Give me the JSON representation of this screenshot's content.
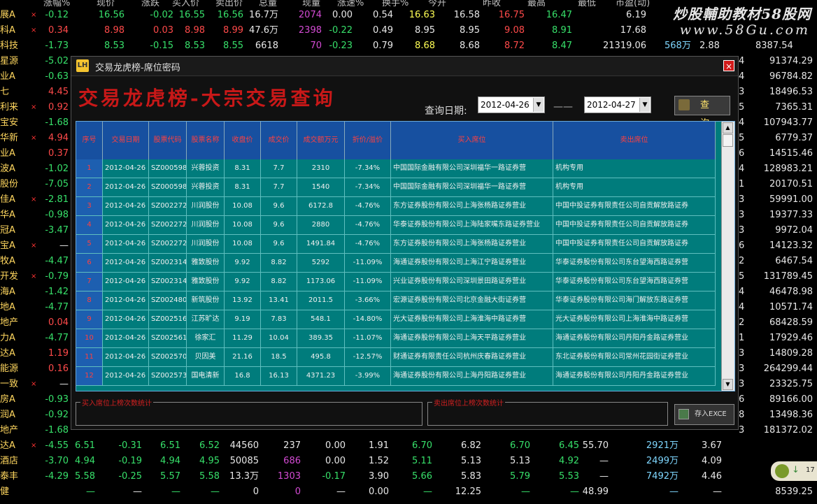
{
  "background": {
    "header": [
      "涨幅%",
      "现价",
      "涨跌",
      "买入价",
      "卖出价",
      "总量",
      "现量",
      "涨速%",
      "换手%",
      "今开",
      "昨收",
      "最高",
      "最低",
      "市盈(动)"
    ],
    "watermark": {
      "line1": "炒股輔助教材58股网",
      "line2": "www.58Gu.com"
    },
    "left_rows": [
      {
        "name": "展A",
        "x": "×",
        "chg": "-0.12"
      },
      {
        "name": "科A",
        "x": "×",
        "chg": "0.34"
      },
      {
        "name": "科技",
        "x": "",
        "chg": "-1.73"
      },
      {
        "name": "星源",
        "x": "",
        "chg": "-5.02"
      },
      {
        "name": "业A",
        "x": "",
        "chg": "-0.63"
      },
      {
        "name": "七",
        "x": "",
        "chg": "4.45"
      },
      {
        "name": "利来",
        "x": "×",
        "chg": "0.92"
      },
      {
        "name": "宝安",
        "x": "",
        "chg": "-1.68"
      },
      {
        "name": "华新",
        "x": "×",
        "chg": "4.94"
      },
      {
        "name": "业A",
        "x": "",
        "chg": "0.37"
      },
      {
        "name": "波A",
        "x": "",
        "chg": "-1.02"
      },
      {
        "name": "股份",
        "x": "",
        "chg": "-7.05"
      },
      {
        "name": "佳A",
        "x": "×",
        "chg": "-2.81"
      },
      {
        "name": "华A",
        "x": "",
        "chg": "-0.98"
      },
      {
        "name": "冠A",
        "x": "",
        "chg": "-3.47"
      },
      {
        "name": "宝A",
        "x": "×",
        "chg": "—"
      },
      {
        "name": "牧A",
        "x": "",
        "chg": "-4.47"
      },
      {
        "name": "开发",
        "x": "×",
        "chg": "-0.79"
      },
      {
        "name": "海A",
        "x": "",
        "chg": "-1.42"
      },
      {
        "name": "地A",
        "x": "",
        "chg": "-4.77"
      },
      {
        "name": "地产",
        "x": "",
        "chg": "0.04"
      },
      {
        "name": "力A",
        "x": "",
        "chg": "-4.77"
      },
      {
        "name": "达A",
        "x": "",
        "chg": "1.19"
      },
      {
        "name": "能源",
        "x": "",
        "chg": "0.16"
      },
      {
        "name": "一致",
        "x": "×",
        "chg": "—"
      },
      {
        "name": "房A",
        "x": "",
        "chg": "-0.93"
      },
      {
        "name": "润A",
        "x": "",
        "chg": "-0.92"
      },
      {
        "name": "地产",
        "x": "",
        "chg": "-1.68"
      },
      {
        "name": "达A",
        "x": "×",
        "chg": "-4.55"
      },
      {
        "name": "酒店",
        "x": "",
        "chg": "-3.70"
      },
      {
        "name": "泰丰",
        "x": "",
        "chg": "-4.29"
      },
      {
        "name": "健",
        "x": "",
        "chg": ""
      }
    ],
    "top_rows": [
      [
        "16.56",
        "-0.02",
        "16.55",
        "16.56",
        "16.7万",
        "2074",
        "0.00",
        "0.54",
        "16.63",
        "16.58",
        "16.75",
        "16.47",
        "6.19"
      ],
      [
        "8.98",
        "0.03",
        "8.98",
        "8.99",
        "47.6万",
        "2398",
        "-0.22",
        "0.49",
        "8.95",
        "8.95",
        "9.08",
        "8.91",
        "17.68"
      ],
      [
        "8.53",
        "-0.15",
        "8.53",
        "8.55",
        "6618",
        "70",
        "-0.23",
        "0.79",
        "8.68",
        "8.68",
        "8.72",
        "8.47",
        "21319.06"
      ]
    ],
    "top_extra": {
      "row3_col14": "568万",
      "row3_col15": "2.88",
      "row3_col16": "8387.54"
    },
    "right_cols": [
      {
        "a": "4",
        "b": "91374.29"
      },
      {
        "a": "4",
        "b": "96784.82"
      },
      {
        "a": "3",
        "b": "18496.53"
      },
      {
        "a": "5",
        "b": "7365.31"
      },
      {
        "a": "4",
        "b": "107943.77"
      },
      {
        "a": "5",
        "b": "6779.37"
      },
      {
        "a": "6",
        "b": "14515.46"
      },
      {
        "a": "4",
        "b": "128983.21"
      },
      {
        "a": "1",
        "b": "20170.51"
      },
      {
        "a": "3",
        "b": "59991.00"
      },
      {
        "a": "3",
        "b": "19377.33"
      },
      {
        "a": "3",
        "b": "9972.04"
      },
      {
        "a": "6",
        "b": "14123.32"
      },
      {
        "a": "2",
        "b": "6467.54"
      },
      {
        "a": "5",
        "b": "131789.45"
      },
      {
        "a": "4",
        "b": "46478.98"
      },
      {
        "a": "4",
        "b": "10571.74"
      },
      {
        "a": "2",
        "b": "68428.59"
      },
      {
        "a": "1",
        "b": "17929.46"
      },
      {
        "a": "3",
        "b": "14809.28"
      },
      {
        "a": "3",
        "b": "264299.44"
      },
      {
        "a": "3",
        "b": "23325.75"
      },
      {
        "a": "6",
        "b": "89166.00"
      },
      {
        "a": "8",
        "b": "13498.36"
      },
      {
        "a": "3",
        "b": "181372.02"
      }
    ],
    "bottom_rows": [
      [
        "6.51",
        "-0.31",
        "6.51",
        "6.52",
        "44560",
        "237",
        "0.00",
        "1.91",
        "6.70",
        "6.82",
        "6.70",
        "6.45",
        "55.70",
        "2921万",
        "3.67",
        "23281.91"
      ],
      [
        "4.94",
        "-0.19",
        "4.94",
        "4.95",
        "50085",
        "686",
        "0.00",
        "1.52",
        "5.11",
        "5.13",
        "5.13",
        "4.92",
        "—",
        "2499万",
        "4.09",
        "68740.93"
      ],
      [
        "5.58",
        "-0.25",
        "5.57",
        "5.58",
        "13.3万",
        "1303",
        "-0.17",
        "3.90",
        "5.66",
        "5.83",
        "5.79",
        "5.53",
        "—",
        "7492万",
        "4.46",
        "28742.93"
      ],
      [
        "—",
        "—",
        "—",
        "—",
        "0",
        "0",
        "—",
        "0.00",
        "—",
        "12.25",
        "—",
        "—",
        "48.99",
        "—",
        "—",
        "8539.25"
      ]
    ]
  },
  "dialog": {
    "logo": "LH",
    "title": "交易龙虎榜-席位密码",
    "close": "×",
    "heading": "交易龙虎榜-大宗交易查询",
    "query_label": "查询日期:",
    "date_from": "2012-04-26",
    "date_to": "2012-04-27",
    "dash": "——",
    "query_button": "查 询",
    "columns": [
      "序号",
      "交易日期",
      "股票代码",
      "股票名称",
      "收盘价",
      "成交价",
      "成交额万元",
      "折价/溢价",
      "买入席位",
      "卖出席位"
    ],
    "rows": [
      [
        "1",
        "2012-04-26",
        "SZ000598",
        "兴蓉投资",
        "8.31",
        "7.7",
        "2310",
        "-7.34%",
        "中国国际金融有限公司深圳福华一路证券营",
        "机构专用"
      ],
      [
        "2",
        "2012-04-26",
        "SZ000598",
        "兴蓉投资",
        "8.31",
        "7.7",
        "1540",
        "-7.34%",
        "中国国际金融有限公司深圳福华一路证券营",
        "机构专用"
      ],
      [
        "3",
        "2012-04-26",
        "SZ002272",
        "川润股份",
        "10.08",
        "9.6",
        "6172.8",
        "-4.76%",
        "东方证券股份有限公司上海张杨路证券营业",
        "中国中投证券有限责任公司自贡解放路证券"
      ],
      [
        "4",
        "2012-04-26",
        "SZ002272",
        "川润股份",
        "10.08",
        "9.6",
        "2880",
        "-4.76%",
        "华泰证券股份有限公司上海陆家嘴东路证券营业",
        "中国中投证券有限责任公司自贡解放路证券"
      ],
      [
        "5",
        "2012-04-26",
        "SZ002272",
        "川润股份",
        "10.08",
        "9.6",
        "1491.84",
        "-4.76%",
        "东方证券股份有限公司上海张杨路证券营业",
        "中国中投证券有限责任公司自贡解放路证券"
      ],
      [
        "6",
        "2012-04-26",
        "SZ002314",
        "雅致股份",
        "9.92",
        "8.82",
        "5292",
        "-11.09%",
        "海通证券股份有限公司上海江宁路证券营业",
        "华泰证券股份有限公司东台望海西路证券营"
      ],
      [
        "7",
        "2012-04-26",
        "SZ002314",
        "雅致股份",
        "9.92",
        "8.82",
        "1173.06",
        "-11.09%",
        "兴业证券股份有限公司深圳景田路证券营业",
        "华泰证券股份有限公司东台望海西路证券营"
      ],
      [
        "8",
        "2012-04-26",
        "SZ002480",
        "新筑股份",
        "13.92",
        "13.41",
        "2011.5",
        "-3.66%",
        "宏源证券股份有限公司北京金融大街证券营",
        "华泰证券股份有限公司海门解放东路证券营"
      ],
      [
        "9",
        "2012-04-26",
        "SZ002516",
        "江苏旷达",
        "9.19",
        "7.83",
        "548.1",
        "-14.80%",
        "光大证券股份有限公司上海淮海中路证券营",
        "光大证券股份有限公司上海淮海中路证券营"
      ],
      [
        "10",
        "2012-04-26",
        "SZ002561",
        "徐家汇",
        "11.29",
        "10.04",
        "389.35",
        "-11.07%",
        "海通证券股份有限公司上海天平路证券营业",
        "海通证券股份有限公司丹阳丹金路证券营业"
      ],
      [
        "11",
        "2012-04-26",
        "SZ002570",
        "贝因美",
        "21.16",
        "18.5",
        "495.8",
        "-12.57%",
        "财通证券有限责任公司杭州庆春路证券营业",
        "东北证券股份有限公司常州花园街证券营业"
      ],
      [
        "12",
        "2012-04-26",
        "SZ002573",
        "国电清新",
        "16.8",
        "16.13",
        "4371.23",
        "-3.99%",
        "海通证券股份有限公司上海丹阳路证券营业",
        "海通证券股份有限公司丹阳丹金路证券营业"
      ]
    ],
    "box1_label": "买入席位上榜次数统计",
    "box2_label": "卖出席位上榜次数统计",
    "export_button": "存入EXCE"
  },
  "tray": {
    "arrow": "↓",
    "text": "17"
  },
  "colors": {
    "accent_red": "#c81818",
    "table_bg": "#007c7c",
    "header_bg": "#1750a0",
    "up": "#ff4a4a",
    "down": "#37e06a"
  }
}
